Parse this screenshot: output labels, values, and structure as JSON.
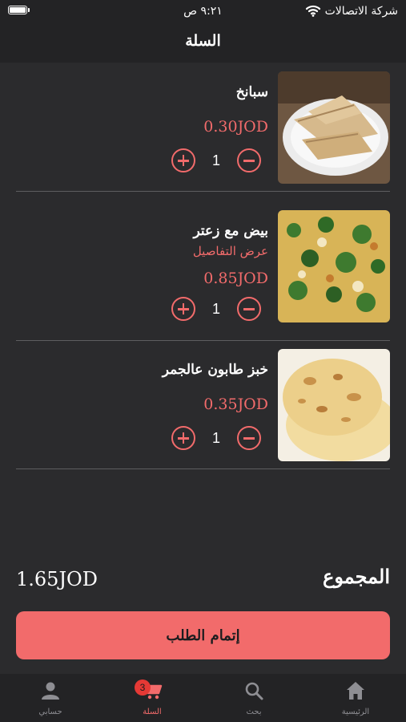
{
  "status_bar": {
    "carrier": "شركة الاتصالات",
    "time": "٩:٢١ ص"
  },
  "header": {
    "title": "السلة"
  },
  "cart": {
    "items": [
      {
        "name": "سبانخ",
        "price": "0.30JOD",
        "quantity": "1"
      },
      {
        "name": "بيض مع زعتر",
        "details_link": "عرض التفاصيل",
        "price": "0.85JOD",
        "quantity": "1"
      },
      {
        "name": "خبز طابون عالجمر",
        "price": "0.35JOD",
        "quantity": "1"
      }
    ]
  },
  "summary": {
    "total_label": "المجموع",
    "total_value": "1.65JOD",
    "checkout_label": "إتمام الطلب"
  },
  "tab_bar": {
    "tabs": [
      {
        "label": "الرئيسية",
        "icon": "home-icon"
      },
      {
        "label": "بحث",
        "icon": "search-icon"
      },
      {
        "label": "السلة",
        "icon": "cart-icon",
        "badge": "3",
        "active": true
      },
      {
        "label": "حسابي",
        "icon": "person-icon"
      }
    ]
  },
  "colors": {
    "accent": "#f26b6b",
    "background": "#2b2b2d",
    "bar_background": "#232325",
    "badge": "#e53935"
  }
}
